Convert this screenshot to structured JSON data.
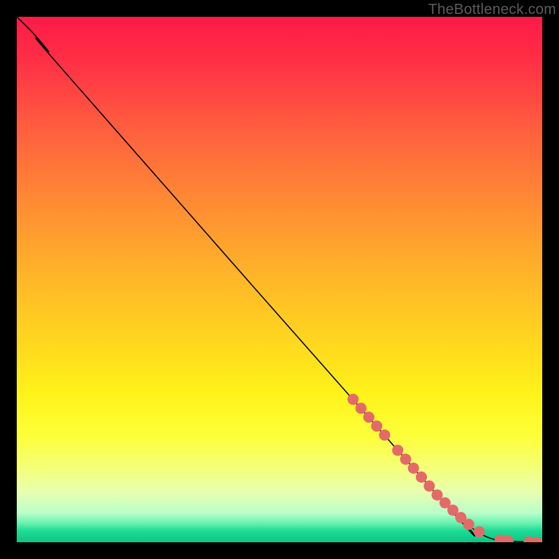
{
  "watermark": "TheBottleneck.com",
  "chart_data": {
    "type": "line",
    "title": "",
    "xlabel": "",
    "ylabel": "",
    "xlim": [
      0,
      100
    ],
    "ylim": [
      0,
      100
    ],
    "grid": false,
    "background_gradient": {
      "stops": [
        {
          "offset": 0.0,
          "color": "#ff1a47"
        },
        {
          "offset": 0.08,
          "color": "#ff2e46"
        },
        {
          "offset": 0.2,
          "color": "#ff5a3f"
        },
        {
          "offset": 0.35,
          "color": "#ff8a34"
        },
        {
          "offset": 0.5,
          "color": "#ffb728"
        },
        {
          "offset": 0.63,
          "color": "#ffda1e"
        },
        {
          "offset": 0.72,
          "color": "#fff31a"
        },
        {
          "offset": 0.8,
          "color": "#fdff3a"
        },
        {
          "offset": 0.86,
          "color": "#f4ff7a"
        },
        {
          "offset": 0.905,
          "color": "#e8ffb0"
        },
        {
          "offset": 0.945,
          "color": "#b8feca"
        },
        {
          "offset": 0.965,
          "color": "#62f0ac"
        },
        {
          "offset": 0.978,
          "color": "#1fdc96"
        },
        {
          "offset": 1.0,
          "color": "#07c784"
        }
      ]
    },
    "series": [
      {
        "name": "curve",
        "stroke": "#000000",
        "stroke_width": 1.6,
        "points": [
          {
            "x": 0.0,
            "y": 100.0
          },
          {
            "x": 3.0,
            "y": 97.0
          },
          {
            "x": 6.0,
            "y": 93.5
          },
          {
            "x": 10.0,
            "y": 88.5
          },
          {
            "x": 80.0,
            "y": 9.0
          },
          {
            "x": 86.0,
            "y": 3.2
          },
          {
            "x": 90.0,
            "y": 0.8
          },
          {
            "x": 94.0,
            "y": 0.2
          },
          {
            "x": 100.0,
            "y": 0.0
          }
        ]
      }
    ],
    "markers": {
      "name": "highlight-dots",
      "color": "#e46a6a",
      "radius": 8,
      "points": [
        {
          "x": 64.0,
          "y": 27.2
        },
        {
          "x": 65.5,
          "y": 25.5
        },
        {
          "x": 67.0,
          "y": 23.8
        },
        {
          "x": 68.5,
          "y": 22.1
        },
        {
          "x": 70.0,
          "y": 20.4
        },
        {
          "x": 72.5,
          "y": 17.5
        },
        {
          "x": 74.0,
          "y": 15.8
        },
        {
          "x": 75.5,
          "y": 14.1
        },
        {
          "x": 77.0,
          "y": 12.4
        },
        {
          "x": 78.5,
          "y": 10.7
        },
        {
          "x": 80.0,
          "y": 9.0
        },
        {
          "x": 81.5,
          "y": 7.5
        },
        {
          "x": 83.0,
          "y": 6.1
        },
        {
          "x": 84.5,
          "y": 4.7
        },
        {
          "x": 86.0,
          "y": 3.4
        },
        {
          "x": 88.0,
          "y": 2.0
        },
        {
          "x": 92.0,
          "y": 0.4
        },
        {
          "x": 93.5,
          "y": 0.25
        },
        {
          "x": 97.5,
          "y": 0.05
        },
        {
          "x": 99.0,
          "y": 0.0
        }
      ]
    }
  }
}
